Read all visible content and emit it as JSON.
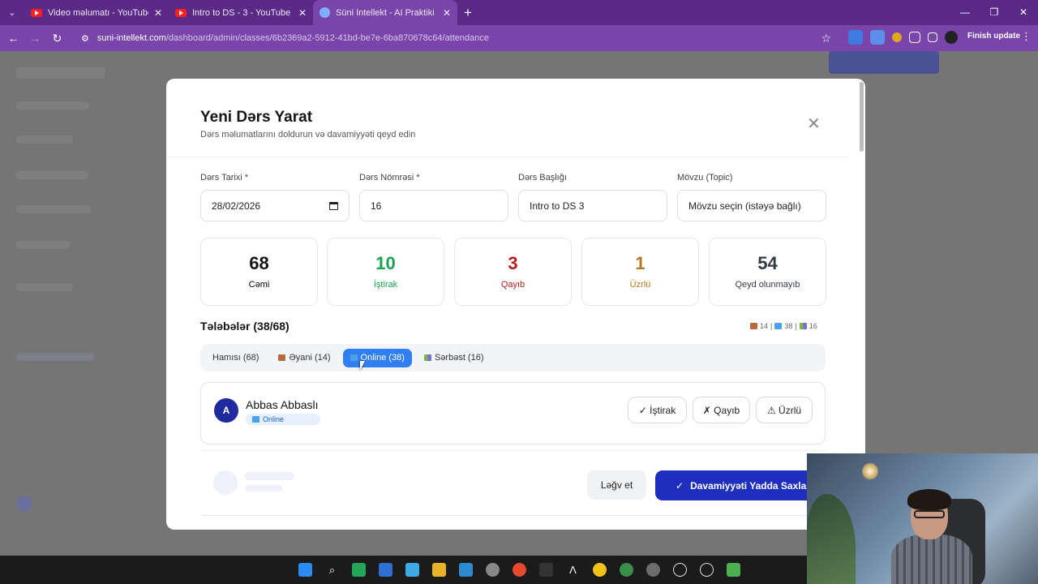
{
  "browser": {
    "tabs": [
      {
        "title": "Video məlumatı - YouTube Studi",
        "icon": "youtube-icon"
      },
      {
        "title": "Intro to DS - 3 - YouTube",
        "icon": "youtube-icon"
      },
      {
        "title": "Süni İntellekt - AI Praktiki Kurs |",
        "icon": "site-icon"
      }
    ],
    "url_domain": "suni-intellekt.com",
    "url_path": "/dashboard/admin/classes/6b2369a2-5912-41bd-be7e-6ba870678c64/attendance",
    "finish_update": "Finish update"
  },
  "modal": {
    "title": "Yeni Dərs Yarat",
    "subtitle": "Dərs məlumatlarını doldurun və davamiyyəti qeyd edin",
    "fields": {
      "date": {
        "label": "Dərs Tarixi *",
        "value": "28/02/2026"
      },
      "number": {
        "label": "Dərs Nömrəsi *",
        "value": "16"
      },
      "lesson_title": {
        "label": "Dərs Başlığı",
        "value": "Intro to DS 3"
      },
      "topic": {
        "label": "Mövzu (Topic)",
        "value": "Mövzu seçin (istəyə bağlı)"
      }
    },
    "stats": [
      {
        "value": "68",
        "label": "Cəmi",
        "color": "#151515"
      },
      {
        "value": "10",
        "label": "İştirak",
        "color": "#16a34a"
      },
      {
        "value": "3",
        "label": "Qayıb",
        "color": "#b91c1c"
      },
      {
        "value": "1",
        "label": "Üzrlü",
        "color": "#b7791f"
      },
      {
        "value": "54",
        "label": "Qeyd olunmayıb",
        "color": "#333a45"
      }
    ],
    "students_title": "Tələbələr (38/68)",
    "mini_stats": {
      "in_person": "14",
      "online": "38",
      "flexible": "16"
    },
    "filters": [
      {
        "label": "Hamısı (68)",
        "icon": ""
      },
      {
        "label": "Əyani (14)",
        "icon": "house-icon"
      },
      {
        "label": "Online (38)",
        "icon": "laptop-icon"
      },
      {
        "label": "Sərbəst (16)",
        "icon": "books-icon"
      }
    ],
    "student": {
      "initial": "A",
      "name": "Abbas Abbaslı",
      "mode": "Online",
      "buttons": {
        "present": "✓ İştirak",
        "absent": "✗ Qayıb",
        "excused": "⚠ Üzrlü"
      }
    },
    "footer": {
      "cancel": "Ləğv et",
      "save": "Davamiyyəti Yadda Saxla"
    }
  }
}
